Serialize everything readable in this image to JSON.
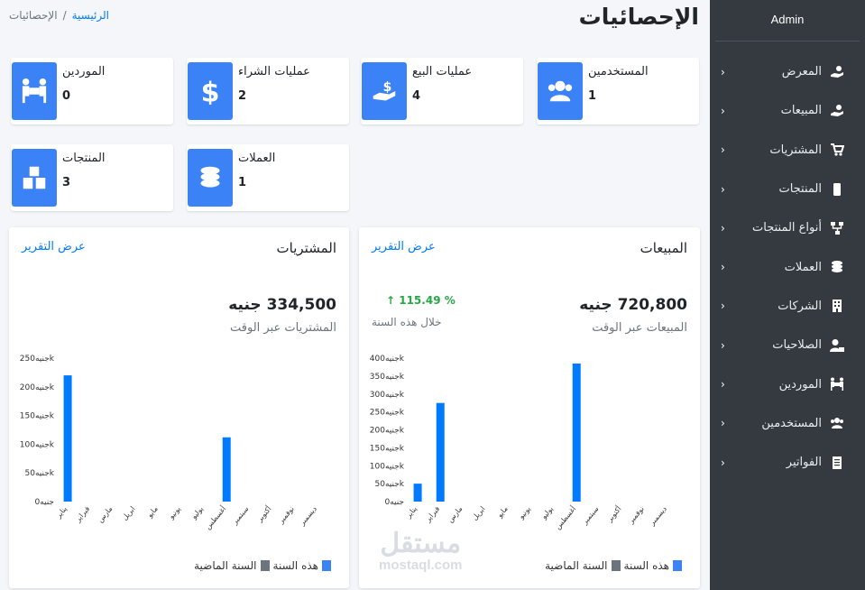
{
  "sidebar": {
    "admin": "Admin",
    "items": [
      {
        "label": "المعرض",
        "icon": "hand-holding-dollar-icon"
      },
      {
        "label": "المبيعات",
        "icon": "hand-holding-dollar-icon"
      },
      {
        "label": "المشتريات",
        "icon": "cart-plus-icon"
      },
      {
        "label": "المنتجات",
        "icon": "mobile-icon"
      },
      {
        "label": "أنواع المنتجات",
        "icon": "sitemap-icon"
      },
      {
        "label": "العملات",
        "icon": "coins-icon"
      },
      {
        "label": "الشركات",
        "icon": "building-icon"
      },
      {
        "label": "الصلاحيات",
        "icon": "user-lock-icon"
      },
      {
        "label": "الموردين",
        "icon": "people-carry-icon"
      },
      {
        "label": "المستخدمين",
        "icon": "users-icon"
      },
      {
        "label": "الفواتير",
        "icon": "receipt-icon"
      }
    ],
    "chevron": "‹"
  },
  "header": {
    "title": "الإحصائيات",
    "breadcrumb_home": "الرئيسية",
    "breadcrumb_sep": "/",
    "breadcrumb_current": "الإحصائيات"
  },
  "stats": {
    "users": {
      "label": "المستخدمين",
      "value": "1",
      "icon": "users-icon"
    },
    "sales_ops": {
      "label": "عمليات البيع",
      "value": "4",
      "icon": "hand-holding-dollar-icon"
    },
    "purchase_ops": {
      "label": "عمليات الشراء",
      "value": "2",
      "icon": "dollar-icon"
    },
    "suppliers": {
      "label": "الموردين",
      "value": "0",
      "icon": "people-carry-icon"
    },
    "currencies": {
      "label": "العملات",
      "value": "1",
      "icon": "coins-icon"
    },
    "products": {
      "label": "المنتجات",
      "value": "3",
      "icon": "boxes-icon"
    }
  },
  "sales_card": {
    "title": "المبيعات",
    "report_link": "عرض التقرير",
    "amount": "720,800 جنيه",
    "subtitle": "المبيعات عبر الوقت",
    "growth": "115.49 %",
    "growth_sub": "خلال هذه السنة",
    "legend_this": "هذه السنة",
    "legend_last": "السنة الماضية"
  },
  "purchases_card": {
    "title": "المشتريات",
    "report_link": "عرض التقرير",
    "amount": "334,500 جنيه",
    "subtitle": "المشتريات عبر الوقت",
    "legend_this": "هذه السنة",
    "legend_last": "السنة الماضية"
  },
  "watermark": {
    "ar": "مستقل",
    "en": "mostaql.com"
  },
  "colors": {
    "accent": "#3b82f6",
    "bar": "#007bff",
    "last_year": "#6c757d",
    "sidebar": "#343a40",
    "growth": "#28a745"
  },
  "chart_data": [
    {
      "type": "bar",
      "title": "المبيعات",
      "categories": [
        "يناير",
        "فبراير",
        "مارس",
        "ابريل",
        "مايو",
        "يونيو",
        "يوليو",
        "أغسطس",
        "سبتمبر",
        "أكتوبر",
        "نوفمبر",
        "ديسمبر"
      ],
      "series": [
        {
          "name": "هذه السنة",
          "values": [
            50000,
            275000,
            0,
            0,
            0,
            0,
            0,
            385000,
            0,
            0,
            0,
            0
          ]
        },
        {
          "name": "السنة الماضية",
          "values": [
            0,
            0,
            0,
            0,
            0,
            0,
            0,
            0,
            0,
            0,
            0,
            0
          ]
        }
      ],
      "yticks": [
        "جنيه0",
        "جنيه50k",
        "جنيه100k",
        "جنيه150k",
        "جنيه200k",
        "جنيه250k",
        "جنيه300k",
        "جنيه350k",
        "جنيه400k"
      ],
      "ylim": [
        0,
        400000
      ],
      "grid": false,
      "legend": "bottom"
    },
    {
      "type": "bar",
      "title": "المشتريات",
      "categories": [
        "يناير",
        "فبراير",
        "مارس",
        "ابريل",
        "مايو",
        "يونيو",
        "يوليو",
        "أغسطس",
        "سبتمبر",
        "أكتوبر",
        "نوفمبر",
        "ديسمبر"
      ],
      "series": [
        {
          "name": "هذه السنة",
          "values": [
            220000,
            0,
            0,
            0,
            0,
            0,
            0,
            112000,
            0,
            0,
            0,
            0
          ]
        },
        {
          "name": "السنة الماضية",
          "values": [
            0,
            0,
            0,
            0,
            0,
            0,
            0,
            0,
            0,
            0,
            0,
            0
          ]
        }
      ],
      "yticks": [
        "جنيه0",
        "جنيه50k",
        "جنيه100k",
        "جنيه150k",
        "جنيه200k",
        "جنيه250k"
      ],
      "ylim": [
        0,
        250000
      ],
      "grid": false,
      "legend": "bottom"
    }
  ]
}
